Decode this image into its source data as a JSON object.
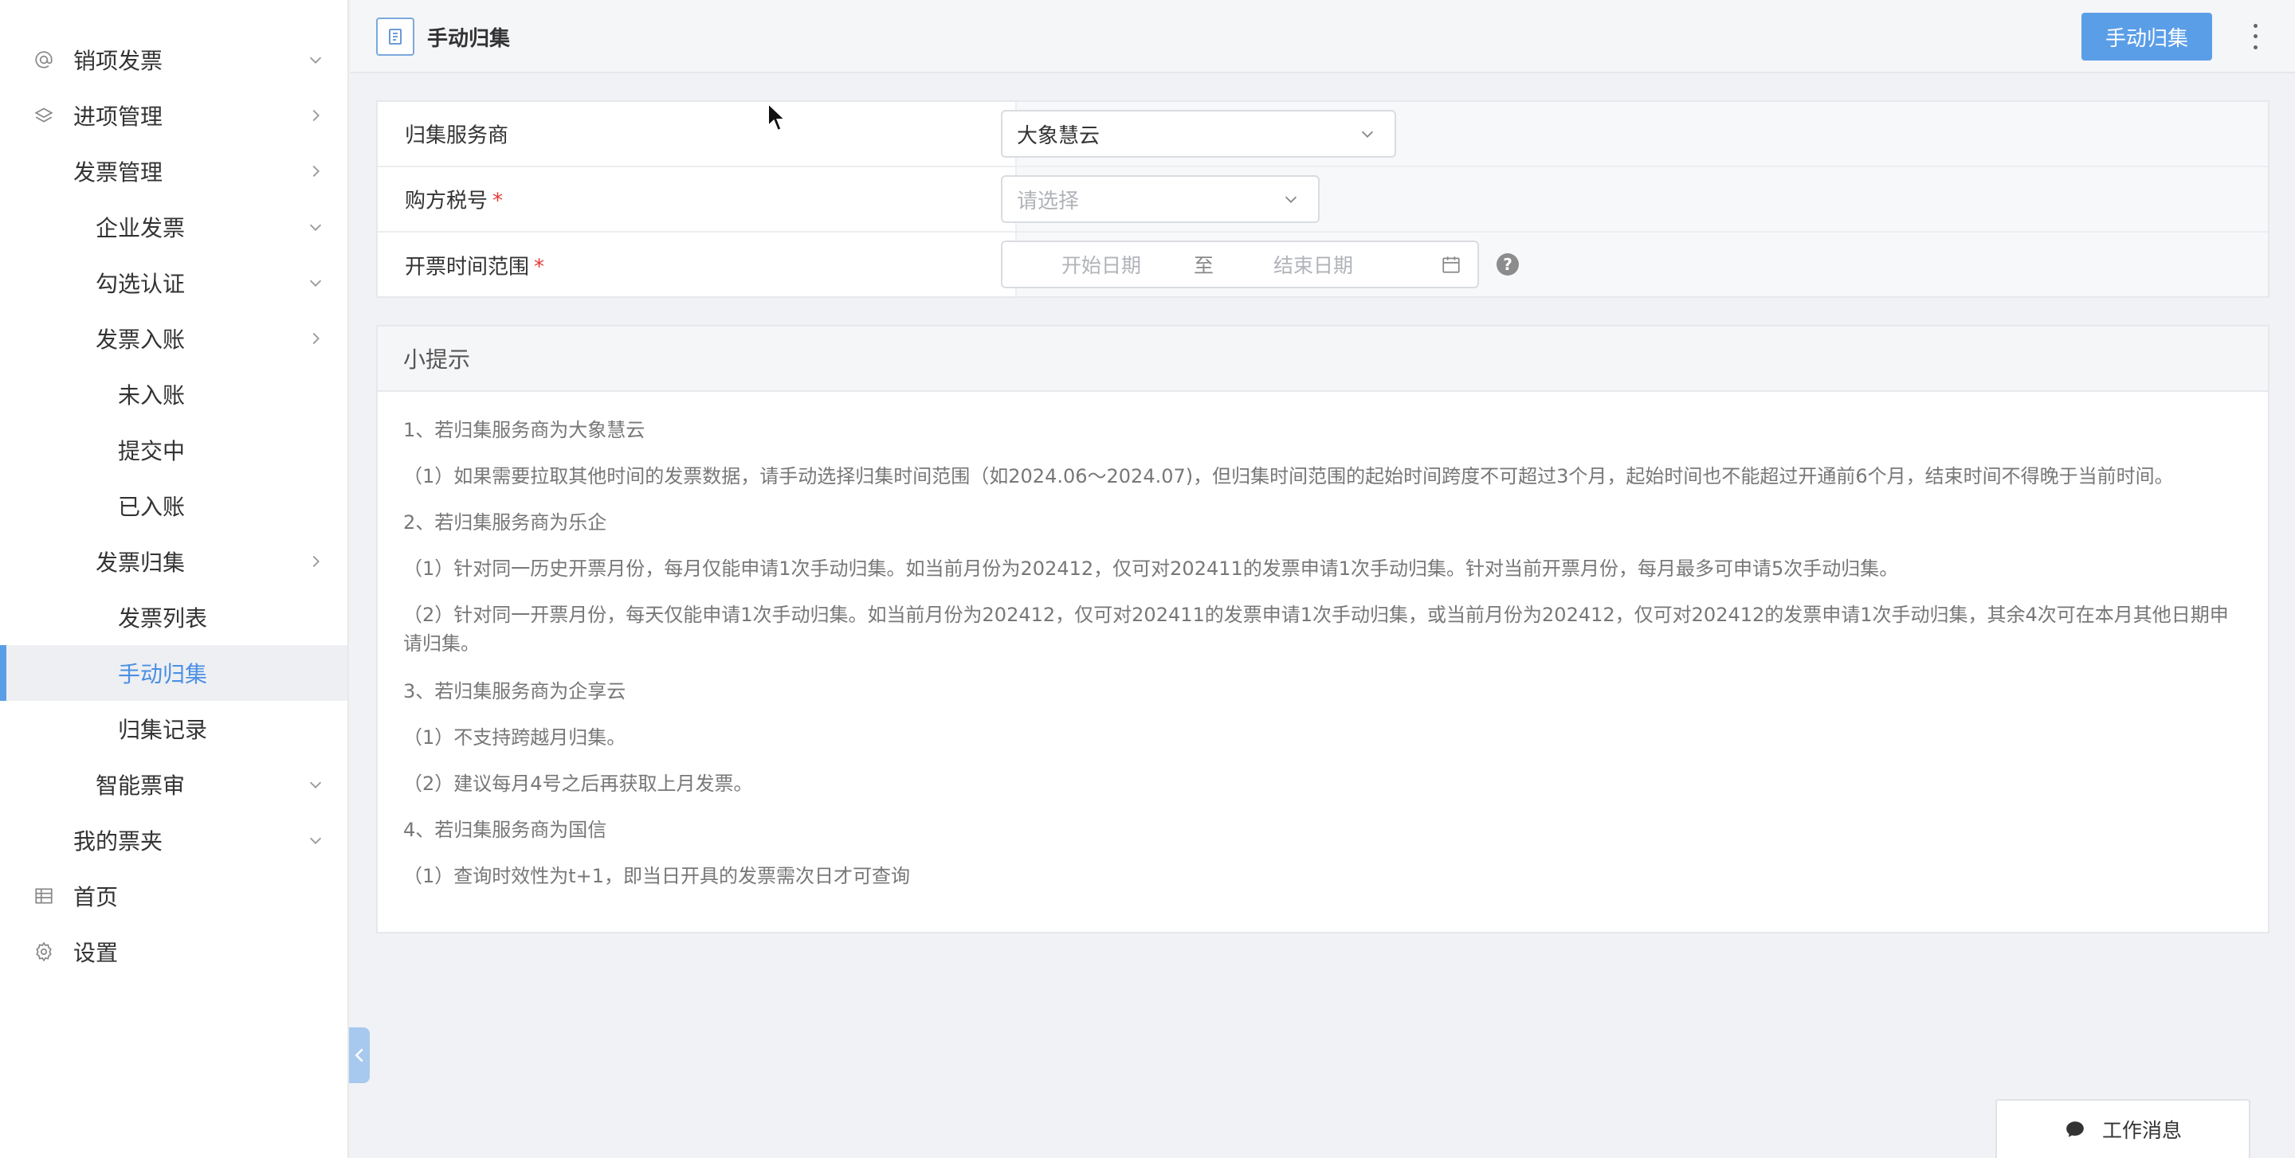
{
  "sidebar": {
    "items": [
      {
        "label": "销项发票",
        "icon": "at-icon",
        "chevron": "down"
      },
      {
        "label": "进项管理",
        "icon": "layers-icon",
        "chevron": "right"
      },
      {
        "label": "发票管理",
        "chevron": "right"
      },
      {
        "label": "企业发票",
        "chevron": "down"
      },
      {
        "label": "勾选认证",
        "chevron": "down"
      },
      {
        "label": "发票入账",
        "chevron": "right"
      },
      {
        "label": "未入账"
      },
      {
        "label": "提交中"
      },
      {
        "label": "已入账"
      },
      {
        "label": "发票归集",
        "chevron": "right"
      },
      {
        "label": "发票列表"
      },
      {
        "label": "手动归集",
        "active": true
      },
      {
        "label": "归集记录"
      },
      {
        "label": "智能票审",
        "chevron": "down"
      },
      {
        "label": "我的票夹",
        "chevron": "down"
      },
      {
        "label": "首页",
        "icon": "table-icon"
      },
      {
        "label": "设置",
        "icon": "gear-icon"
      }
    ]
  },
  "header": {
    "title": "手动归集",
    "action_label": "手动归集"
  },
  "form": {
    "provider": {
      "label": "归集服务商",
      "value": "大象慧云"
    },
    "buyer_tax": {
      "label": "购方税号",
      "placeholder": "请选择"
    },
    "date_range": {
      "label": "开票时间范围",
      "start_placeholder": "开始日期",
      "separator": "至",
      "end_placeholder": "结束日期"
    }
  },
  "tips": {
    "title": "小提示",
    "lines": [
      "1、若归集服务商为大象慧云",
      "（1）如果需要拉取其他时间的发票数据，请手动选择归集时间范围（如2024.06～2024.07)，但归集时间范围的起始时间跨度不可超过3个月，起始时间也不能超过开通前6个月，结束时间不得晚于当前时间。",
      "2、若归集服务商为乐企",
      "（1）针对同一历史开票月份，每月仅能申请1次手动归集。如当前月份为202412，仅可对202411的发票申请1次手动归集。针对当前开票月份，每月最多可申请5次手动归集。",
      "（2）针对同一开票月份，每天仅能申请1次手动归集。如当前月份为202412，仅可对202411的发票申请1次手动归集，或当前月份为202412，仅可对202412的发票申请1次手动归集，其余4次可在本月其他日期申请归集。",
      "3、若归集服务商为企享云",
      "（1）不支持跨越月归集。",
      "（2）建议每月4号之后再获取上月发票。",
      "4、若归集服务商为国信",
      "（1）查询时效性为t+1，即当日开具的发票需次日才可查询"
    ]
  },
  "work_message": {
    "label": "工作消息"
  },
  "colors": {
    "accent": "#5b9ee8",
    "required": "#e53935",
    "active_text": "#4a90e2"
  }
}
